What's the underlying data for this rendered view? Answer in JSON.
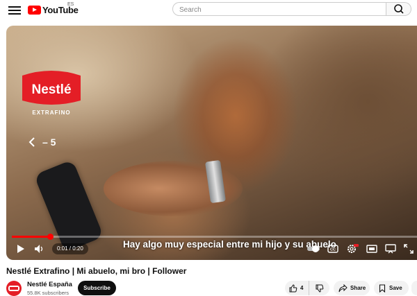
{
  "header": {
    "logo_text": "YouTube",
    "country_code": "ES",
    "search_placeholder": "Search"
  },
  "player": {
    "skip_back_label": "– 5",
    "subtitle": "Hay algo muy especial entre mi hijo y su abuelo",
    "time": "0:01 / 0:20",
    "progress_fraction": 0.095,
    "brand_logo_text": "Nestlé",
    "brand_logo_subtext": "EXTRAFINO",
    "icons": [
      "play-icon",
      "volume-icon",
      "autoplay-toggle-icon",
      "captions-icon",
      "settings-icon",
      "miniplayer-icon",
      "cast-icon",
      "fullscreen-icon"
    ]
  },
  "video": {
    "title": "Nestlé Extrafino | Mi abuelo, mi bro | Follower",
    "channel_name": "Nestlé España",
    "subscribers": "55.8K subscribers",
    "subscribe_label": "Subscribe",
    "like_count": "4",
    "share_label": "Share",
    "save_label": "Save"
  },
  "colors": {
    "brand_red": "#ff0000",
    "nestle_red": "#e41e26"
  }
}
